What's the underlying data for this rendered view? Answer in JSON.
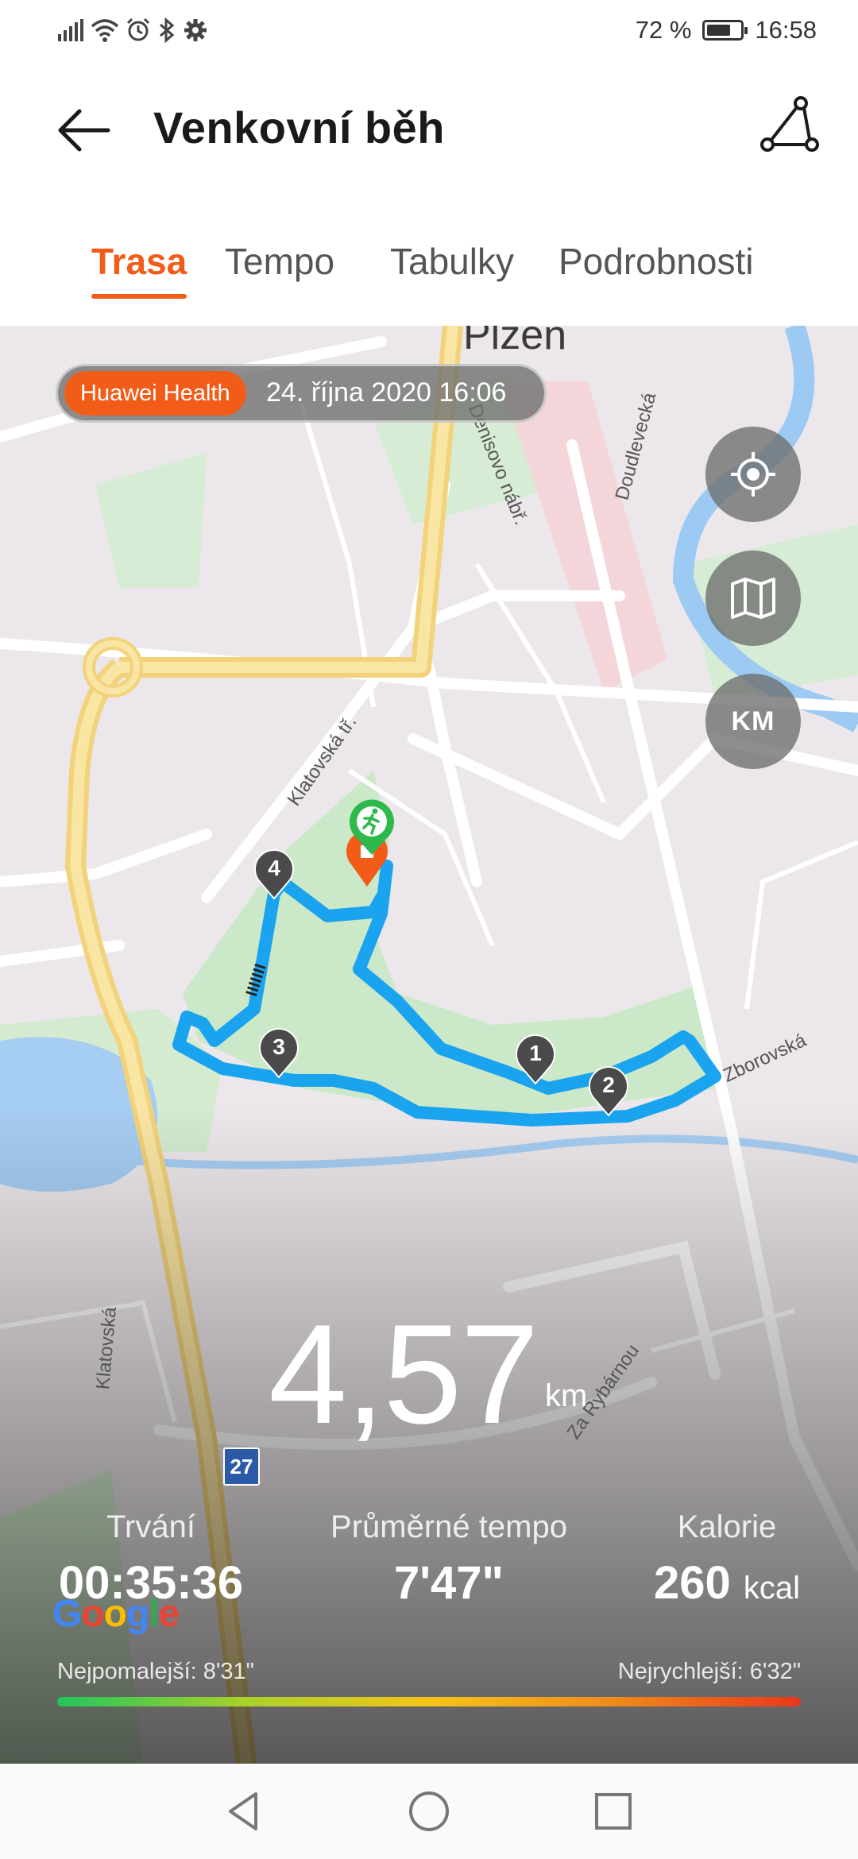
{
  "status_bar": {
    "battery": "72 %",
    "battery_level": 0.72,
    "time": "16:58",
    "icons": [
      "signal-icon",
      "wifi-icon",
      "alarm-icon",
      "bluetooth-icon",
      "settings-icon"
    ]
  },
  "header": {
    "title": "Venkovní běh",
    "back_icon": "arrow-left-icon",
    "route_icon": "route-icon"
  },
  "tabs": [
    {
      "label": "Trasa",
      "active": true
    },
    {
      "label": "Tempo",
      "active": false
    },
    {
      "label": "Tabulky",
      "active": false
    },
    {
      "label": "Podrobnosti",
      "active": false
    }
  ],
  "map": {
    "city": "Plzeň",
    "source_badge": "Huawei Health",
    "date": "24. října 2020 16:06",
    "street_labels": [
      "Klatovská tř.",
      "Doudlevecká",
      "Zborovská",
      "Za Rybárnou",
      "Klatovská",
      "Denisovo nábř."
    ],
    "road_number": "27",
    "km_markers": [
      "1",
      "2",
      "3",
      "4"
    ],
    "buttons": {
      "locate_icon": "crosshair-icon",
      "map_icon": "map-icon",
      "km_label": "KM"
    },
    "google": "Google"
  },
  "stats": {
    "distance": "4,57",
    "distance_unit": "km",
    "duration_label": "Trvání",
    "duration": "00:35:36",
    "avg_pace_label": "Průměrné tempo",
    "avg_pace": "7'47\"",
    "calories_label": "Kalorie",
    "calories": "260",
    "calories_unit": "kcal",
    "slowest": "Nejpomalejší: 8'31\"",
    "fastest": "Nejrychlejší: 6'32\""
  },
  "colors": {
    "accent": "#f25c19",
    "route": "#1aa3ee",
    "start_marker": "#2fb84c"
  },
  "nav_bar": {
    "icons": [
      "back-triangle-icon",
      "home-circle-icon",
      "recents-square-icon"
    ]
  }
}
